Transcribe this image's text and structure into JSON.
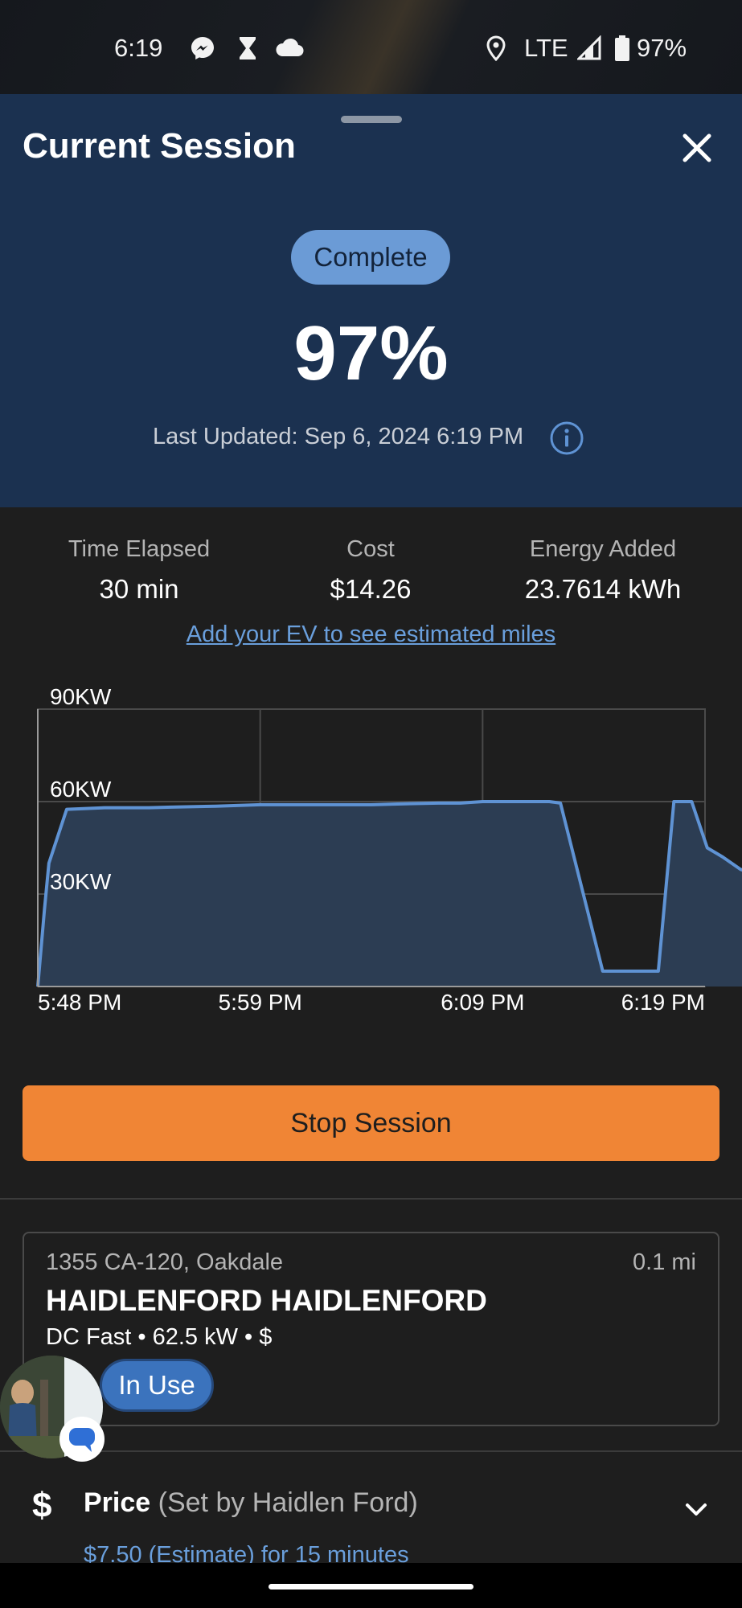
{
  "status_bar": {
    "time": "6:19",
    "network": "LTE",
    "battery": "97%",
    "icons": [
      "messenger-icon",
      "hourglass-icon",
      "cloud-icon",
      "location-icon",
      "signal-icon",
      "battery-icon"
    ]
  },
  "header": {
    "title": "Current Session",
    "status": "Complete",
    "charge_percent": "97%",
    "last_updated": "Last Updated: Sep 6, 2024 6:19 PM"
  },
  "stats": {
    "time_elapsed_label": "Time Elapsed",
    "time_elapsed_value": "30 min",
    "cost_label": "Cost",
    "cost_value": "$14.26",
    "energy_label": "Energy Added",
    "energy_value": "23.7614 kWh"
  },
  "add_ev_link": "Add your EV to see estimated miles",
  "chart_data": {
    "type": "area",
    "title": "",
    "xlabel": "",
    "ylabel": "",
    "y_tick_labels": [
      "90KW",
      "60KW",
      "30KW"
    ],
    "x_tick_labels": [
      "5:48 PM",
      "5:59 PM",
      "6:09 PM",
      "6:19 PM"
    ],
    "xlim": [
      0,
      30
    ],
    "ylim": [
      0,
      90
    ],
    "grid": true,
    "series": [
      {
        "x": [
          0,
          0.3,
          0.5,
          1.3,
          3,
          4,
          5,
          6,
          8,
          10,
          12,
          14,
          15,
          16,
          18,
          19,
          20,
          21,
          22,
          23,
          23.5,
          25.4,
          26.5,
          27.4,
          27.9,
          28.6,
          29.4,
          30.1,
          30.8,
          31.6,
          32.5,
          33.5,
          34.6,
          35.8,
          37.1,
          38.1,
          40
        ],
        "y": [
          0,
          25,
          40,
          57.5,
          58,
          58,
          58,
          58.2,
          58.5,
          59,
          59,
          59,
          59,
          59.2,
          59.5,
          59.5,
          60,
          60,
          60,
          60,
          59.5,
          5,
          5,
          5,
          5,
          60,
          60,
          45,
          42,
          38,
          36,
          33,
          31,
          29.5,
          29.5,
          29.5,
          29.5
        ]
      }
    ],
    "colors": {
      "line": "#5f93d4",
      "fill": "#2c3d53"
    }
  },
  "stop_button": "Stop Session",
  "station": {
    "address": "1355 CA-120, Oakdale",
    "distance": "0.1 mi",
    "name": "HAIDLENFORD HAIDLENFORD",
    "details": "DC Fast • 62.5 kW • $",
    "availability": "In Use"
  },
  "price": {
    "label": "Price",
    "sub_label": "(Set by Haidlen Ford)",
    "estimate": "$7.50 (Estimate) for 15 minutes"
  },
  "colors": {
    "header_bg": "#1b3150",
    "body_bg": "#1e1e1e",
    "accent_orange": "#f08535",
    "pill_blue": "#6b9bd6",
    "link_blue": "#6a9fdc"
  }
}
